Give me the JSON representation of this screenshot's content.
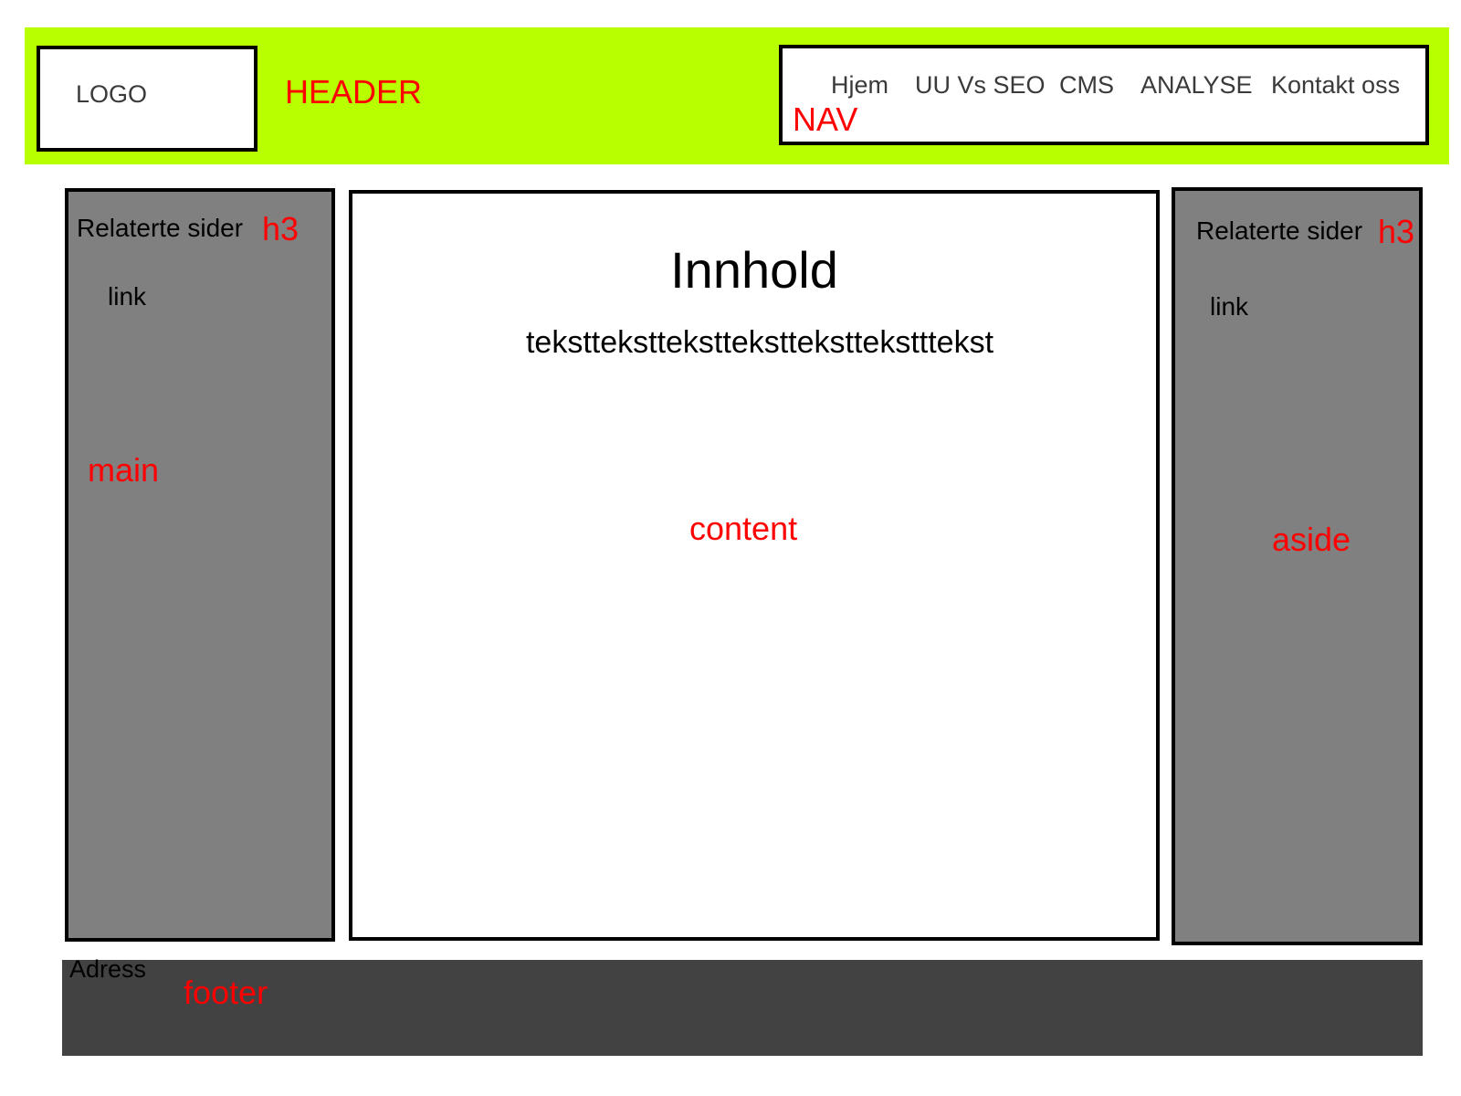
{
  "header": {
    "logo": "LOGO",
    "label": "HEADER",
    "background": "#b8ff00"
  },
  "nav": {
    "items": [
      "Hjem",
      "UU Vs SEO",
      "CMS",
      "ANALYSE",
      "Kontakt oss"
    ],
    "label": "NAV"
  },
  "main": {
    "heading": "Relaterte sider",
    "heading_tag": "h3",
    "link": "link",
    "label": "main",
    "background": "#808080"
  },
  "content": {
    "title": "Innhold",
    "text": "teksttekstteksttekstteksttekstttekst",
    "label": "content"
  },
  "aside": {
    "heading": "Relaterte sider",
    "heading_tag": "h3",
    "link": "link",
    "label": "aside",
    "background": "#808080"
  },
  "footer": {
    "text": "Adress",
    "label": "footer",
    "background": "#424242"
  },
  "annotation_color": "#ff0000"
}
